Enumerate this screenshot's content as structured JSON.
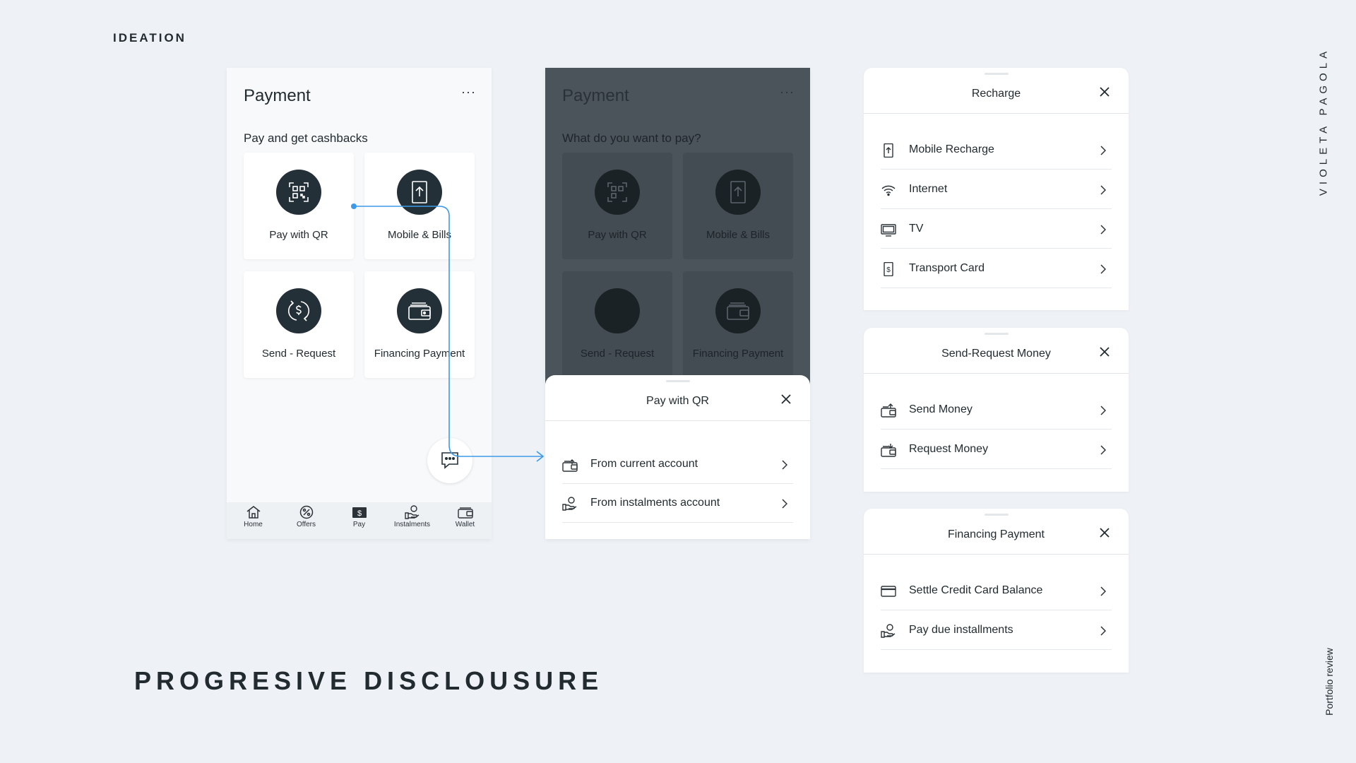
{
  "page": {
    "section_label": "IDEATION",
    "title": "PROGRESIVE DISCLOUSURE",
    "author": "VIOLETA PAGOLA",
    "footer": "Portfolio review"
  },
  "colors": {
    "background": "#eef2f6",
    "dark": "#243038",
    "accent": "#3d9ae8",
    "dim_overlay": "#4b545b"
  },
  "screen1": {
    "title": "Payment",
    "menu": "···",
    "subtitle": "Pay and get cashbacks",
    "tiles": [
      {
        "label": "Pay with QR",
        "icon": "qr-code-icon"
      },
      {
        "label": "Mobile & Bills",
        "icon": "mobile-upload-icon"
      },
      {
        "label": "Send - Request",
        "icon": "send-request-dollar-icon"
      },
      {
        "label": "Financing Payment",
        "icon": "wallet-icon"
      }
    ],
    "tabs": [
      {
        "label": "Home",
        "icon": "home-icon"
      },
      {
        "label": "Offers",
        "icon": "percent-badge-icon"
      },
      {
        "label": "Pay",
        "icon": "pay-dollar-icon"
      },
      {
        "label": "Instalments",
        "icon": "instalments-hand-icon"
      },
      {
        "label": "Wallet",
        "icon": "wallet-icon"
      }
    ]
  },
  "screen2": {
    "title": "Payment",
    "menu": "···",
    "subtitle": "What do you want to pay?",
    "tiles": [
      {
        "label": "Pay with QR"
      },
      {
        "label": "Mobile & Bills"
      },
      {
        "label": "Send - Request"
      },
      {
        "label": "Financing Payment"
      }
    ],
    "sheet": {
      "title": "Pay with QR",
      "rows": [
        {
          "label": "From current account",
          "icon": "wallet-account-icon"
        },
        {
          "label": "From instalments account",
          "icon": "instalments-hand-icon"
        }
      ]
    }
  },
  "recharge": {
    "title": "Recharge",
    "rows": [
      {
        "label": "Mobile Recharge",
        "icon": "mobile-upload-icon"
      },
      {
        "label": "Internet",
        "icon": "wifi-icon"
      },
      {
        "label": "TV",
        "icon": "tv-icon"
      },
      {
        "label": "Transport Card",
        "icon": "transport-card-icon"
      }
    ]
  },
  "send_request": {
    "title": "Send-Request Money",
    "rows": [
      {
        "label": "Send Money",
        "icon": "send-money-icon"
      },
      {
        "label": "Request Money",
        "icon": "request-money-icon"
      }
    ]
  },
  "financing": {
    "title": "Financing Payment",
    "rows": [
      {
        "label": "Settle Credit Card Balance",
        "icon": "credit-card-icon"
      },
      {
        "label": "Pay due installments",
        "icon": "instalments-hand-icon"
      }
    ]
  }
}
